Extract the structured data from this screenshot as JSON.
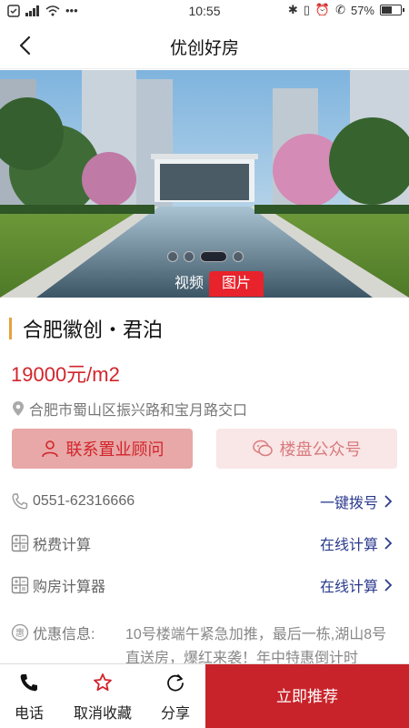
{
  "status_bar": {
    "time": "10:55",
    "battery": "57%",
    "battery_level": 0.57
  },
  "nav": {
    "title": "优创好房",
    "back_icon": "chevron-left-icon"
  },
  "gallery": {
    "dots_count": 4,
    "active_dot": 2,
    "tab_video": "视频",
    "tab_photo": "图片"
  },
  "property": {
    "name": "合肥徽创・君泊",
    "price": "19000元/m2",
    "address": "合肥市蜀山区振兴路和宝月路交口"
  },
  "buttons": {
    "consult": "联系置业顾问",
    "wechat": "楼盘公众号"
  },
  "rows": {
    "phone": "0551-62316666",
    "phone_action": "一键拨号",
    "tax": "税费计算",
    "tax_action": "在线计算",
    "calc": "购房计算器",
    "calc_action": "在线计算"
  },
  "promo": {
    "label": "优惠信息:",
    "text": "10号楼端午紧急加推，最后一栋,湖山8号直送房，爆红来袭！年中特惠倒计时"
  },
  "bottom_bar": {
    "phone": "电话",
    "unfavorite": "取消收藏",
    "share": "分享",
    "recommend": "立即推荐"
  },
  "colors": {
    "accent_red": "#d2242b",
    "cta_red": "#c8232a",
    "link_blue": "#2a3a8c",
    "title_bar_orange": "#e8a13c"
  }
}
